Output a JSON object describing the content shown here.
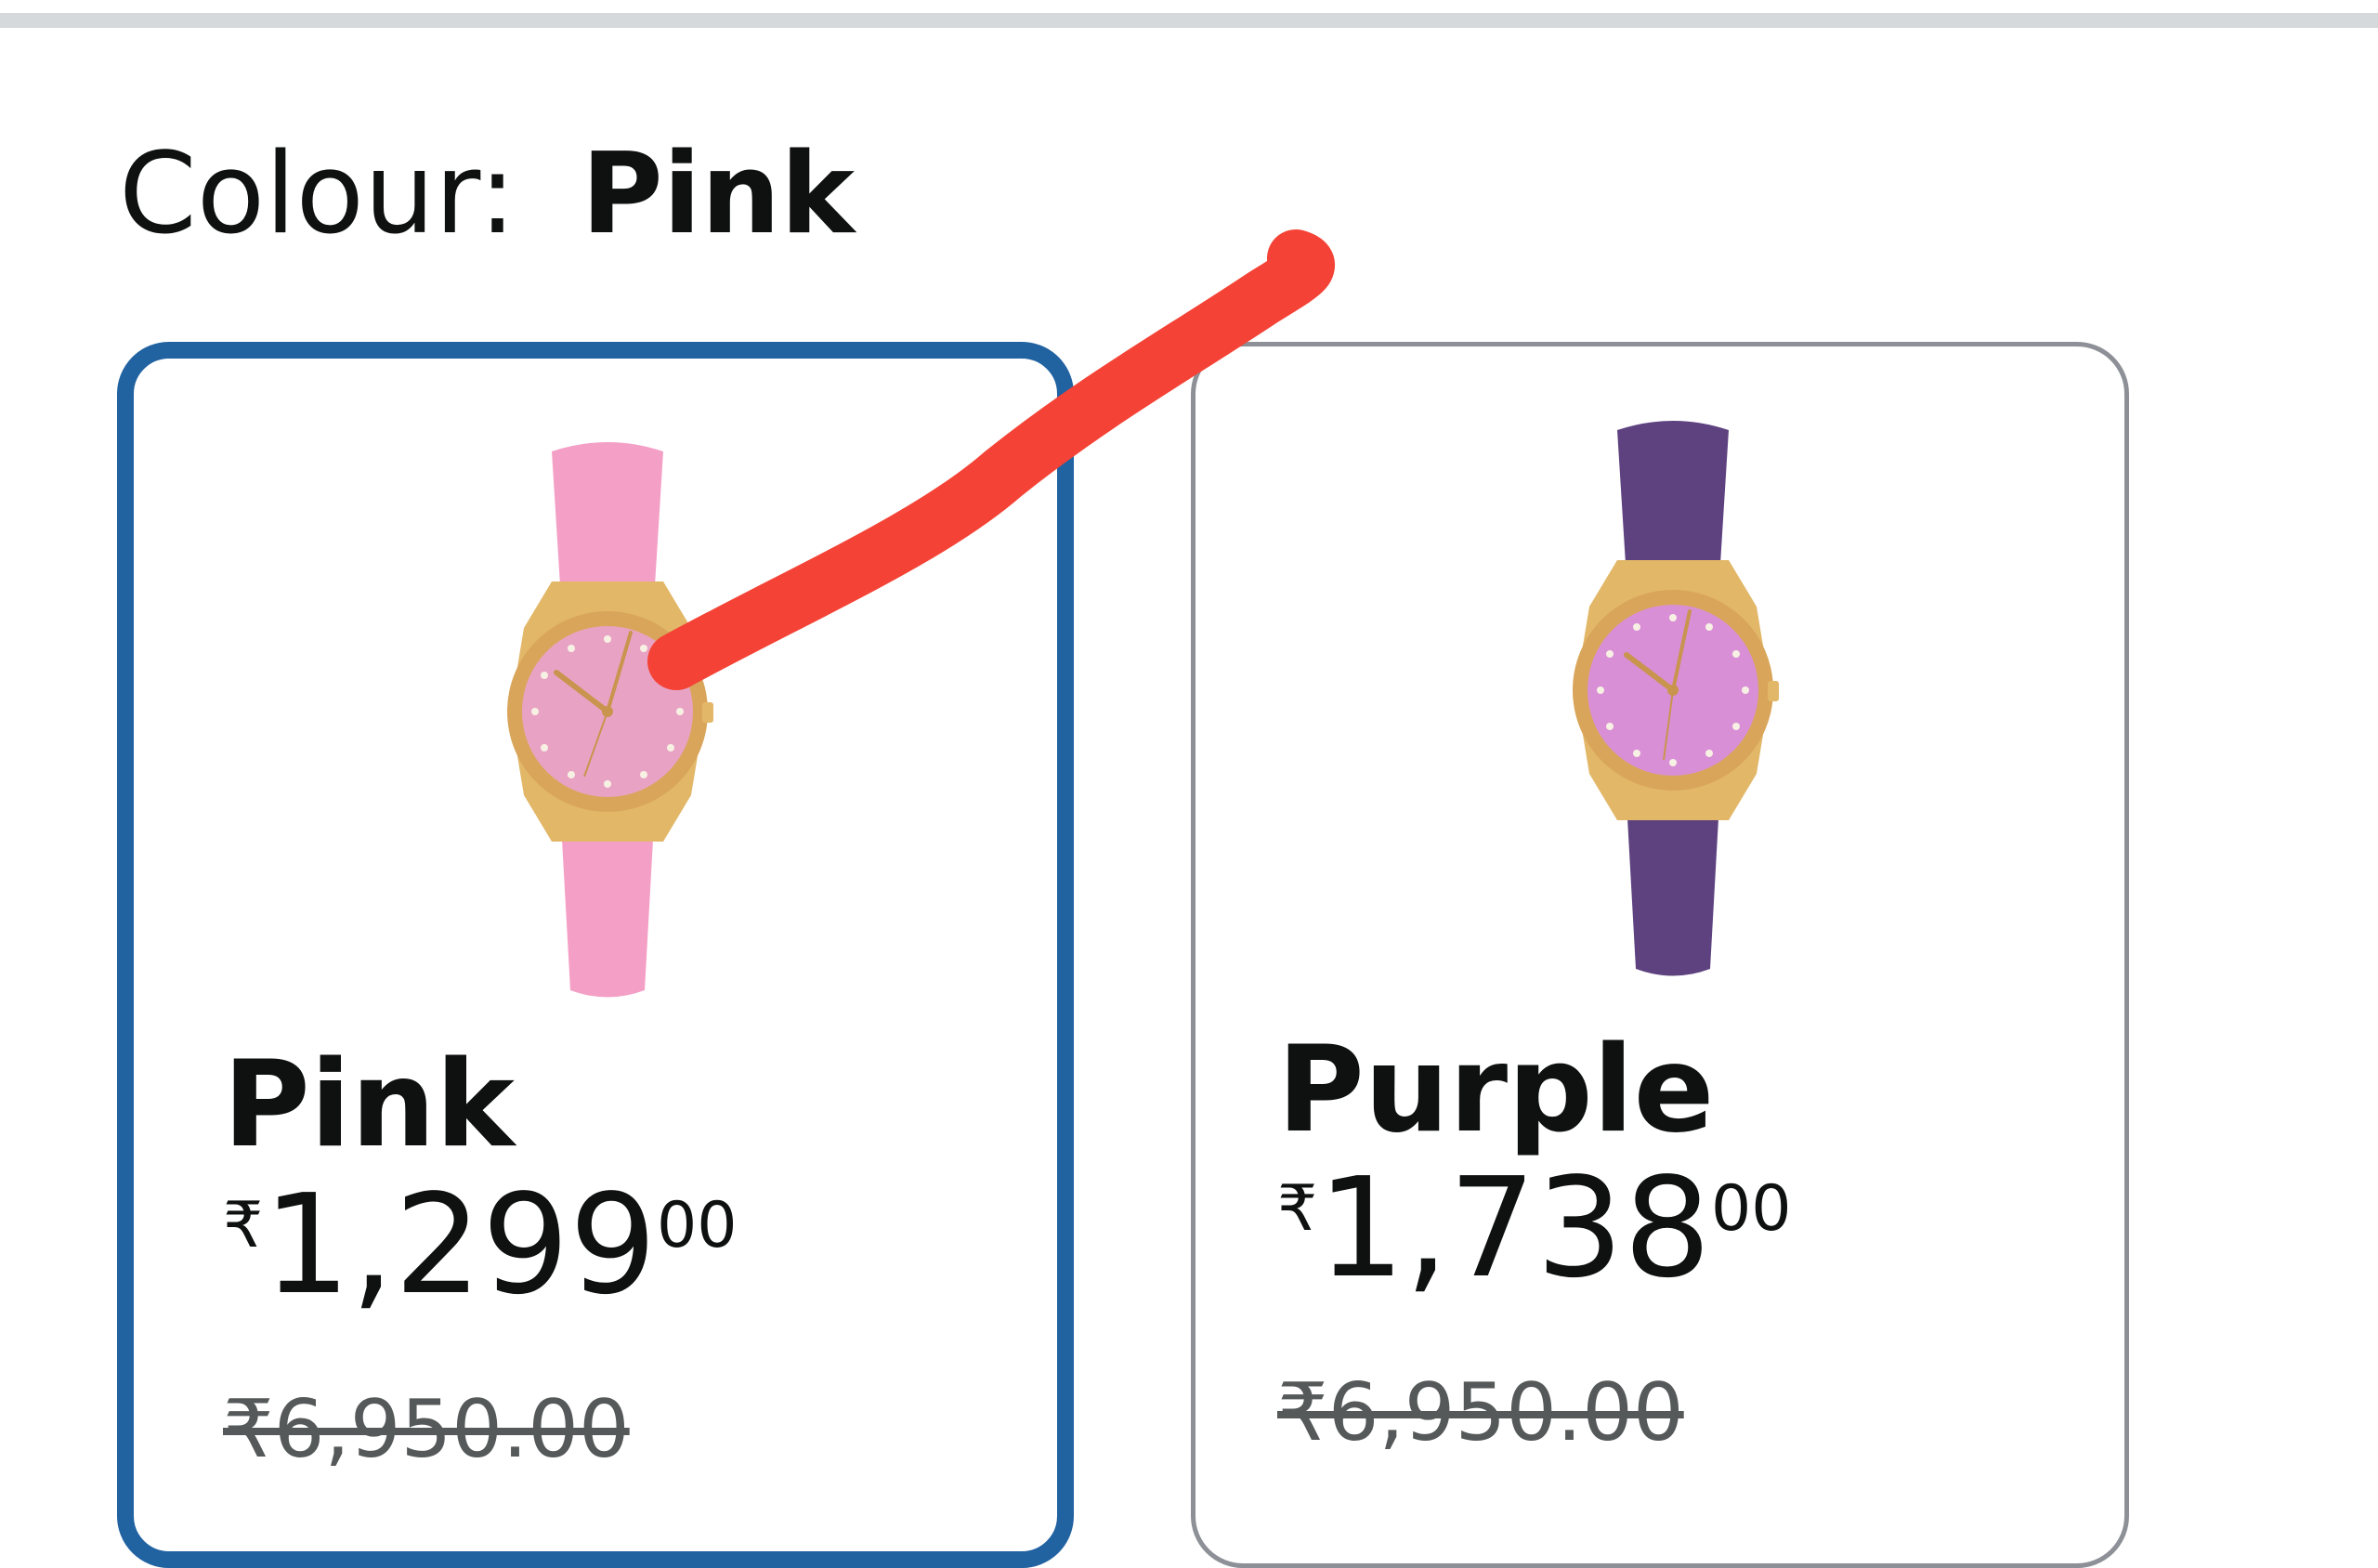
{
  "colour": {
    "label": "Colour:",
    "selected_value": "Pink"
  },
  "swatches": [
    {
      "name": "Pink",
      "price_symbol": "₹",
      "price_whole": "1,299",
      "price_fraction": "00",
      "mrp": "₹6,950.00",
      "selected": true,
      "strap_color": "#f49fc6",
      "dial_color": "#e8a3c4"
    },
    {
      "name": "Purple",
      "price_symbol": "₹",
      "price_whole": "1,738",
      "price_fraction": "00",
      "mrp": "₹6,950.00",
      "selected": false,
      "strap_color": "#5e4280",
      "dial_color": "#d98fd6"
    }
  ],
  "colors": {
    "selected_border": "#2162a1",
    "unselected_border": "#8d9096",
    "annotation_stroke": "#f44336",
    "case_gold": "#e2b768"
  },
  "icons": [
    "watch-pink-image",
    "watch-purple-image",
    "annotation-stroke"
  ]
}
